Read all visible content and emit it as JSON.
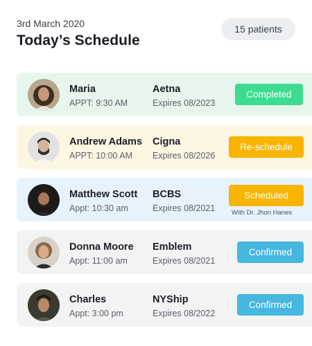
{
  "header": {
    "date": "3rd March 2020",
    "title": "Today’s Schedule",
    "patient_count": "15 patients"
  },
  "colors": {
    "completed": "#3ddc91",
    "reschedule": "#f7b500",
    "scheduled": "#f7b500",
    "confirmed": "#45b7e0",
    "row_green": "#e6f6ec",
    "row_yellow": "#fdf6e3",
    "row_blue": "#e6f3fc",
    "row_gray": "#f3f3f3"
  },
  "appointments": [
    {
      "name": "Maria",
      "appt": "APPT: 9:30 AM",
      "insurer": "Aetna",
      "expires": "Expires 08/2023",
      "status": "Completed",
      "avatar_icon": "woman-avatar"
    },
    {
      "name": "Andrew Adams",
      "appt": "APPT: 10:00 AM",
      "insurer": "Cigna",
      "expires": "Expires 08/2026",
      "status": "Re-schedule",
      "avatar_icon": "bearded-man-avatar"
    },
    {
      "name": "Matthew Scott",
      "appt": "Appt: 10:30 am",
      "insurer": "BCBS",
      "expires": "Expires 08/2021",
      "status": "Scheduled",
      "status_note": "With Dr. Jhon Hanes",
      "avatar_icon": "man-avatar"
    },
    {
      "name": "Donna Moore",
      "appt": "Appt: 11:00 am",
      "insurer": "Emblem",
      "expires": "Expires 08/2021",
      "status": "Confirmed",
      "avatar_icon": "woman-avatar"
    },
    {
      "name": "Charles",
      "appt": "Appt: 3:00 pm",
      "insurer": "NYShip",
      "expires": "Expires 08/2022",
      "status": "Confirmed",
      "avatar_icon": "man-avatar"
    }
  ]
}
